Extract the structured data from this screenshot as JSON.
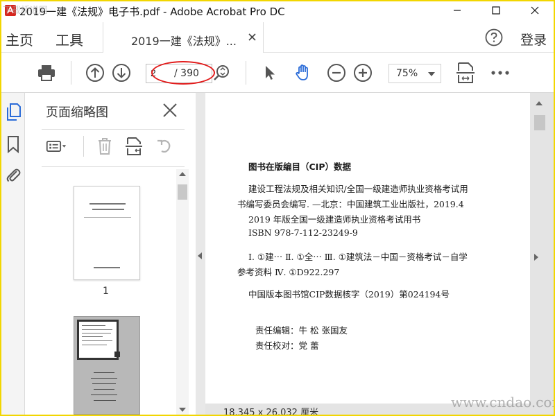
{
  "window": {
    "title": "2019一建《法规》电子书.pdf - Adobe Acrobat Pro DC"
  },
  "menu": {
    "home": "主页",
    "tools": "工具",
    "tab_title": "2019一建《法规》...",
    "login": "登录"
  },
  "toolbar": {
    "page_current": "2",
    "page_total": "/ 390",
    "zoom": "75%"
  },
  "sidebar": {
    "title": "页面缩略图",
    "thumb1_number": "1"
  },
  "document": {
    "lines": [
      "图书在版编目（CIP）数据",
      "建设工程法规及相关知识/全国一级建造师执业资格考试用",
      "书编写委员会编写. —北京：中国建筑工业出版社，2019.4",
      "2019 年版全国一级建造师执业资格考试用书",
      "ISBN 978-7-112-23249-9",
      "Ⅰ. ①建⋯  Ⅱ. ①全⋯  Ⅲ. ①建筑法－中国－资格考试－自学",
      "参考资料  Ⅳ. ①D922.297",
      "中国版本图书馆CIP数据核字（2019）第024194号",
      "责任编辑：牛    松    张国友",
      "责任校对：党    蕾"
    ],
    "page_size": "18.345 x 26.032 厘米"
  },
  "watermark": {
    "top_left": "下载桥道网",
    "bottom_right": "www.cndao.com"
  },
  "colors": {
    "accent_blue": "#2a6bd8",
    "highlight_red": "#e21b1b",
    "frame_yellow": "#f2d600"
  }
}
